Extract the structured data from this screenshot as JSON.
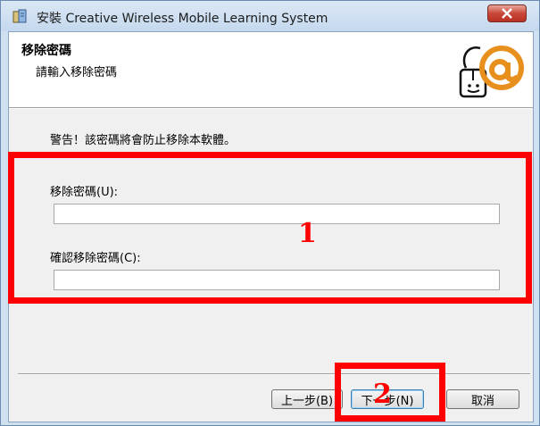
{
  "window": {
    "title": "安裝 Creative Wireless Mobile Learning System",
    "close_icon": "close-icon"
  },
  "header": {
    "title": "移除密碼",
    "subtitle": "請輸入移除密碼"
  },
  "content": {
    "warning": "警告！該密碼將會防止移除本軟體。",
    "remove_password_label": "移除密碼(U):",
    "remove_password_value": "",
    "confirm_password_label": "確認移除密碼(C):",
    "confirm_password_value": ""
  },
  "buttons": {
    "back": "上一步(B)",
    "next": "下一步(N)",
    "cancel": "取消"
  },
  "annotations": {
    "box1_number": "1",
    "box2_number": "2",
    "color": "#ff0000"
  }
}
